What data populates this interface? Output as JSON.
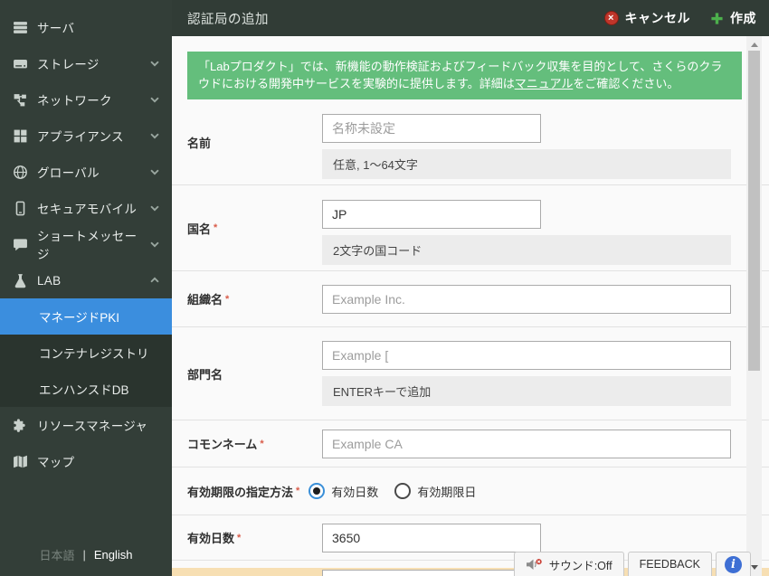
{
  "sidebar": {
    "items": [
      {
        "label": "サーバ",
        "icon": "server"
      },
      {
        "label": "ストレージ",
        "icon": "storage",
        "chevron": "down"
      },
      {
        "label": "ネットワーク",
        "icon": "network",
        "chevron": "down"
      },
      {
        "label": "アプライアンス",
        "icon": "appliance",
        "chevron": "down"
      },
      {
        "label": "グローバル",
        "icon": "globe",
        "chevron": "down"
      },
      {
        "label": "セキュアモバイル",
        "icon": "mobile",
        "chevron": "down"
      },
      {
        "label": "ショートメッセージ",
        "icon": "message",
        "chevron": "down"
      },
      {
        "label": "LAB",
        "icon": "flask",
        "chevron": "up"
      }
    ],
    "lab_children": [
      {
        "label": "マネージドPKI",
        "selected": true
      },
      {
        "label": "コンテナレジストリ",
        "selected": false
      },
      {
        "label": "エンハンスドDB",
        "selected": false
      }
    ],
    "items_bottom": [
      {
        "label": "リソースマネージャ",
        "icon": "puzzle"
      },
      {
        "label": "マップ",
        "icon": "map"
      }
    ],
    "language": {
      "japanese": "日本語",
      "separator": "|",
      "english": "English"
    }
  },
  "header": {
    "title": "認証局の追加",
    "cancel_label": "キャンセル",
    "create_label": "作成",
    "cancel_icon": "×"
  },
  "banner": {
    "text_before": "「Labプロダクト」では、新機能の動作検証およびフィードバック収集を目的として、さくらのクラウドにおける開発中サービスを実験的に提供します。詳細は",
    "link_text": "マニュアル",
    "text_after": "をご確認ください。"
  },
  "form": {
    "name": {
      "label": "名前",
      "placeholder": "名称未設定",
      "hint": "任意, 1～64文字"
    },
    "country": {
      "label": "国名",
      "required": "*",
      "value": "JP",
      "hint": "2文字の国コード"
    },
    "organization": {
      "label": "組織名",
      "required": "*",
      "placeholder": "Example Inc."
    },
    "unit": {
      "label": "部門名",
      "placeholder": "Example [",
      "hint": "ENTERキーで追加"
    },
    "common_name": {
      "label": "コモンネーム",
      "required": "*",
      "placeholder": "Example CA"
    },
    "expiry_method": {
      "label": "有効期限の指定方法",
      "required": "*",
      "options": [
        {
          "label": "有効日数",
          "selected": true
        },
        {
          "label": "有効期限日",
          "selected": false
        }
      ]
    },
    "valid_days": {
      "label": "有効日数",
      "required": "*",
      "value": "3650"
    }
  },
  "overlay": {
    "sound_label": "サウンド:Off",
    "feedback_label": "FEEDBACK",
    "info_glyph": "i"
  },
  "colors": {
    "sidebar_bg": "#333e38",
    "submenu_bg": "#2a342e",
    "selected_blue": "#3b8ede",
    "banner_green": "#64be7c",
    "cancel_red": "#bf352a",
    "create_green": "#4cb04c",
    "bottom_strip_orange": "#f7dfb3"
  }
}
